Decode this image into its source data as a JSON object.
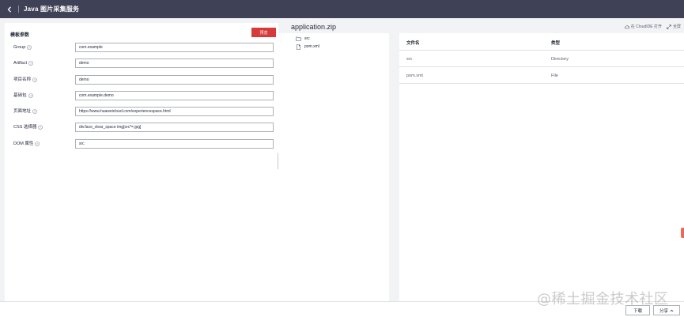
{
  "header": {
    "title": "Java 图片采集服务",
    "back_icon": "chevron-left-icon"
  },
  "form": {
    "section_title": "模板参数",
    "preview_label": "预览",
    "fields": [
      {
        "label": "Group",
        "value": "com.example"
      },
      {
        "label": "Artifact",
        "value": "demo"
      },
      {
        "label": "项目名称",
        "value": "demo"
      },
      {
        "label": "基础包",
        "value": "com.example.demo"
      },
      {
        "label": "页面地址",
        "value": "https://www.huaweicloud.com/experiencespace.html"
      },
      {
        "label": "CSS 选择器",
        "value": "div.face_clear_space img[src*=.jpg]"
      },
      {
        "label": "DOM 属性",
        "value": "src"
      }
    ]
  },
  "archive": {
    "name": "application.zip",
    "open_in_cloudide": "在 CloudIDE 打开",
    "fullscreen": "全屏",
    "tree": [
      {
        "name": "src",
        "icon": "folder-icon"
      },
      {
        "name": "pom.xml",
        "icon": "file-icon"
      }
    ],
    "columns": [
      "文件名",
      "类型"
    ],
    "rows": [
      {
        "name": "src",
        "type": "Directory"
      },
      {
        "name": "pom.xml",
        "type": "File"
      }
    ]
  },
  "footer": {
    "download_label": "下载",
    "share_label": "分享"
  },
  "watermark": "@稀土掘金技术社区",
  "colors": {
    "topbar": "#3f4256",
    "primary_button": "#d63a3a",
    "accent_mark": "#e96b55"
  }
}
